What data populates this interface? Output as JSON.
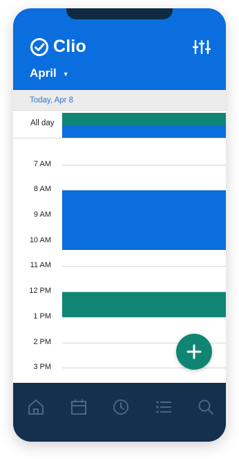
{
  "app": {
    "name": "Clio"
  },
  "header": {
    "month": "April"
  },
  "today_bar": {
    "label": "Today, Apr 8"
  },
  "allday": {
    "label": "All day"
  },
  "timeline": {
    "hours": [
      "7 AM",
      "8 AM",
      "9 AM",
      "10 AM",
      "11 AM",
      "12 PM",
      "1 PM",
      "2 PM",
      "3 PM"
    ]
  },
  "colors": {
    "brand_blue": "#0a6ede",
    "event_blue": "#0a6ede",
    "event_green": "#118573",
    "nav_bg": "#13304d"
  },
  "icons": {
    "logo": "check-circle-icon",
    "filter": "sliders-icon",
    "add": "plus-icon",
    "nav": [
      "home-icon",
      "calendar-icon",
      "clock-icon",
      "list-icon",
      "search-icon"
    ]
  }
}
